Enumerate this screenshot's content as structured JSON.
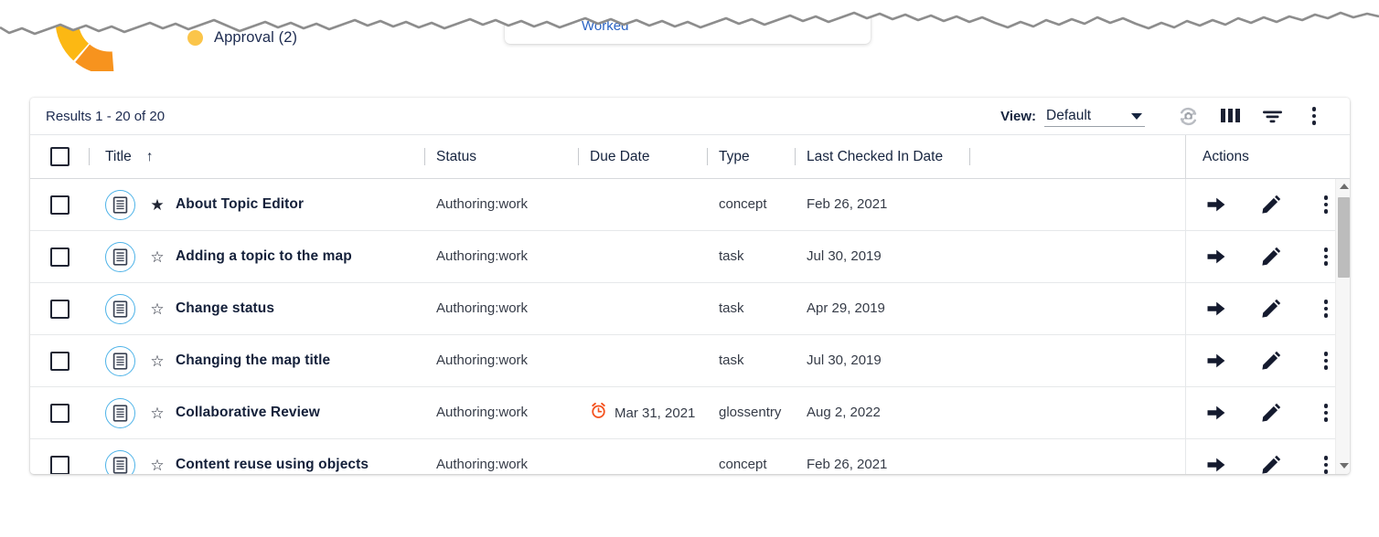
{
  "top_widgets": {
    "legend": [
      {
        "label": "Approval (2)",
        "color": "#fbc54a",
        "icon": "legend-dot"
      }
    ],
    "donut": {
      "segments": [
        {
          "color": "#f7931e",
          "label": ""
        },
        {
          "color": "#fcb813",
          "label": ""
        },
        {
          "color": "#fdd668",
          "label": ""
        }
      ]
    },
    "mini_card": {
      "clipped_title": "Worked"
    }
  },
  "results_bar": {
    "count_text": "Results 1 - 20 of 20",
    "view_label": "View:",
    "view_value": "Default",
    "view_options": [
      "Default"
    ],
    "icons": [
      {
        "name": "refresh-icon"
      },
      {
        "name": "columns-icon"
      },
      {
        "name": "filter-icon"
      },
      {
        "name": "more-options-icon"
      }
    ]
  },
  "table": {
    "columns": [
      {
        "key": "title",
        "label": "Title",
        "sort": "asc",
        "sort_glyph": "↑"
      },
      {
        "key": "status",
        "label": "Status"
      },
      {
        "key": "due_date",
        "label": "Due Date"
      },
      {
        "key": "type",
        "label": "Type"
      },
      {
        "key": "last_checked_in",
        "label": "Last Checked In Date"
      },
      {
        "key": "actions",
        "label": "Actions"
      }
    ],
    "row_actions": [
      {
        "name": "go-to-icon",
        "glyph": "➤"
      },
      {
        "name": "edit-pencil-icon"
      },
      {
        "name": "row-more-options-icon"
      }
    ],
    "rows": [
      {
        "title": "About Topic Editor",
        "favorite": true,
        "star_glyph": "★",
        "doc_icon": "topic-document-icon",
        "status": "Authoring:work",
        "due_date": "",
        "due_overdue": false,
        "type": "concept",
        "last_checked_in": "Feb 26, 2021"
      },
      {
        "title": "Adding a topic to the map",
        "favorite": false,
        "star_glyph": "☆",
        "doc_icon": "topic-document-icon",
        "status": "Authoring:work",
        "due_date": "",
        "due_overdue": false,
        "type": "task",
        "last_checked_in": "Jul 30, 2019"
      },
      {
        "title": "Change status",
        "favorite": false,
        "star_glyph": "☆",
        "doc_icon": "topic-document-icon",
        "status": "Authoring:work",
        "due_date": "",
        "due_overdue": false,
        "type": "task",
        "last_checked_in": "Apr 29, 2019"
      },
      {
        "title": "Changing the map title",
        "favorite": false,
        "star_glyph": "☆",
        "doc_icon": "topic-document-icon",
        "status": "Authoring:work",
        "due_date": "",
        "due_overdue": false,
        "type": "task",
        "last_checked_in": "Jul 30, 2019"
      },
      {
        "title": "Collaborative Review",
        "favorite": false,
        "star_glyph": "☆",
        "doc_icon": "topic-document-icon",
        "status": "Authoring:work",
        "due_date": "Mar 31, 2021",
        "due_overdue": true,
        "type": "glossentry",
        "last_checked_in": "Aug 2, 2022"
      },
      {
        "title": "Content reuse using objects",
        "favorite": false,
        "star_glyph": "☆",
        "doc_icon": "topic-document-icon",
        "status": "Authoring:work",
        "due_date": "",
        "due_overdue": false,
        "type": "concept",
        "last_checked_in": "Feb 26, 2021"
      }
    ]
  },
  "colors": {
    "accent_blue": "#4eb3e8",
    "overdue_orange": "#f4511e",
    "text_dark": "#14203a",
    "legend_yellow": "#fbc54a"
  }
}
